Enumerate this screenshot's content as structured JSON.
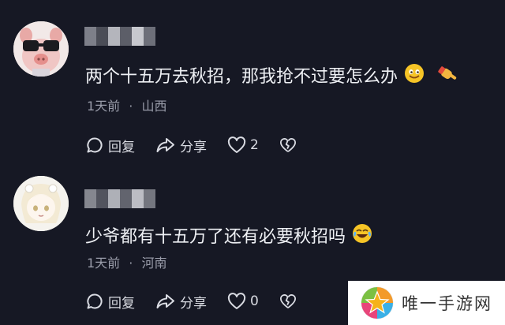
{
  "comments": [
    {
      "text": "两个十五万去秋招，那我抢不过要怎么办",
      "time": "1天前",
      "separator": "·",
      "location": "山西",
      "reply_label": "回复",
      "share_label": "分享",
      "like_count": "2",
      "emojis": [
        "smiling-face-emoji",
        "pointing-hand-emoji"
      ]
    },
    {
      "text": "少爷都有十五万了还有必要秋招吗",
      "time": "1天前",
      "separator": "·",
      "location": "河南",
      "reply_label": "回复",
      "share_label": "分享",
      "like_count": "0",
      "emojis": [
        "tears-of-joy-emoji"
      ]
    }
  ],
  "watermark": {
    "text": "唯一手游网"
  },
  "colors": {
    "background": "#161824",
    "text": "#eef0f4",
    "meta": "#9a9daa",
    "accent_star": "#f5b21a"
  }
}
